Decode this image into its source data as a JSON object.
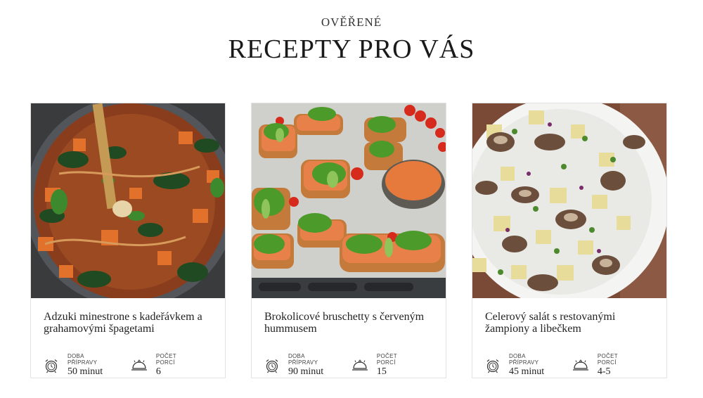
{
  "header": {
    "kicker": "OVĚŘENÉ",
    "title": "RECEPTY PRO VÁS"
  },
  "labels": {
    "prep_time": "DOBA PŘÍPRAVY",
    "servings": "POČET PORCÍ"
  },
  "icons": {
    "prep_time": "alarm-clock-icon",
    "servings": "cloche-icon"
  },
  "recipes": [
    {
      "title": "Adzuki minestrone s kadeřávkem a grahamovými špagetami",
      "prep_time": "50 minut",
      "servings": "6",
      "image": "soup-pot-photo"
    },
    {
      "title": "Brokolicové bruschetty s červeným hummusem",
      "prep_time": "90 minut",
      "servings": "15",
      "image": "bruschetta-tray-photo"
    },
    {
      "title": "Celerový salát s restovanými žampiony a libečkem",
      "prep_time": "45 minut",
      "servings": "4-5",
      "image": "mushroom-salad-photo"
    }
  ]
}
